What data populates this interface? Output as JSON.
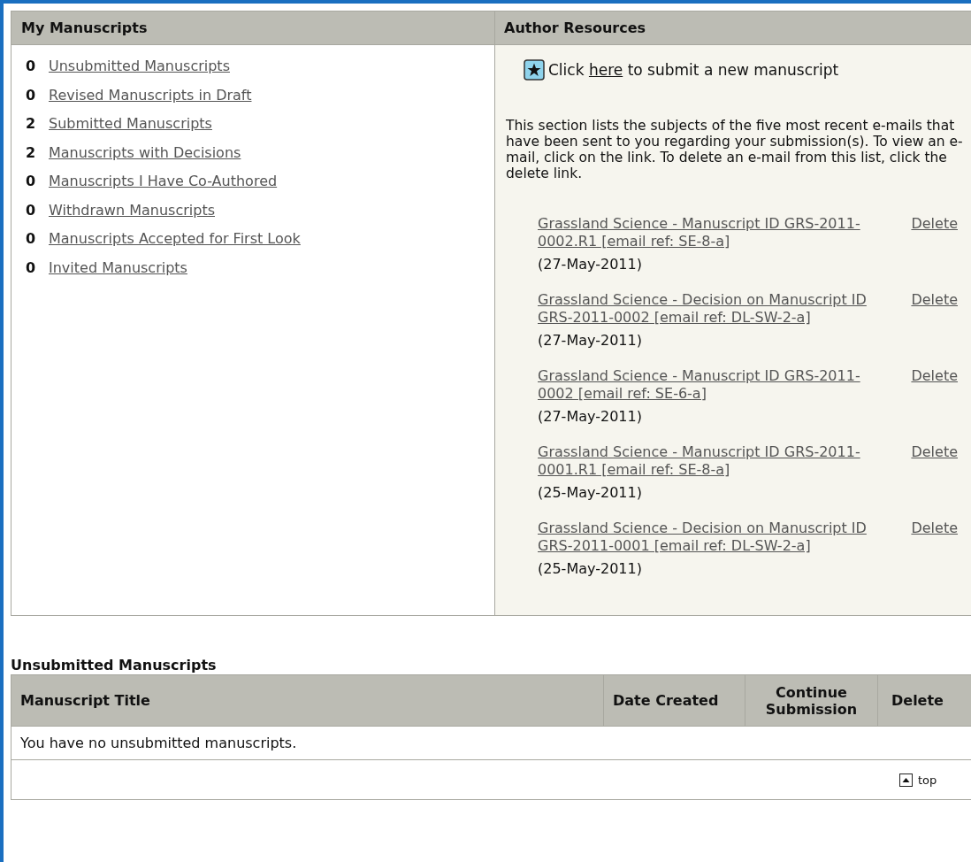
{
  "my_manuscripts": {
    "title": "My Manuscripts",
    "items": [
      {
        "count": "0",
        "label": "Unsubmitted Manuscripts"
      },
      {
        "count": "0",
        "label": "Revised Manuscripts in Draft"
      },
      {
        "count": "2",
        "label": "Submitted Manuscripts"
      },
      {
        "count": "2",
        "label": "Manuscripts with Decisions"
      },
      {
        "count": "0",
        "label": "Manuscripts I Have Co-Authored"
      },
      {
        "count": "0",
        "label": "Withdrawn Manuscripts"
      },
      {
        "count": "0",
        "label": "Manuscripts Accepted for First Look"
      },
      {
        "count": "0",
        "label": "Invited Manuscripts"
      }
    ]
  },
  "author_resources": {
    "title": "Author Resources",
    "submit_prefix": "Click",
    "submit_link": "here",
    "submit_suffix": "to submit a new manuscript",
    "description": "This section lists the subjects of the five most recent e-mails that have been sent to you regarding your submission(s). To view an e-mail, click on the link. To delete an e-mail from this list, click the delete link.",
    "emails": [
      {
        "subject": "Grassland Science - Manuscript ID GRS-2011-0002.R1 [email ref: SE-8-a]",
        "delete": "Delete",
        "date": "(27-May-2011)"
      },
      {
        "subject": "Grassland Science - Decision on Manuscript ID GRS-2011-0002 [email ref: DL-SW-2-a]",
        "delete": "Delete",
        "date": "(27-May-2011)"
      },
      {
        "subject": "Grassland Science - Manuscript ID GRS-2011-0002 [email ref: SE-6-a]",
        "delete": "Delete",
        "date": "(27-May-2011)"
      },
      {
        "subject": "Grassland Science - Manuscript ID GRS-2011-0001.R1 [email ref: SE-8-a]",
        "delete": "Delete",
        "date": "(25-May-2011)"
      },
      {
        "subject": "Grassland Science - Decision on Manuscript ID GRS-2011-0001 [email ref: DL-SW-2-a]",
        "delete": "Delete",
        "date": "(25-May-2011)"
      }
    ]
  },
  "unsubmitted": {
    "title": "Unsubmitted Manuscripts",
    "columns": [
      "Manuscript Title",
      "Date Created",
      "Continue Submission",
      "Delete"
    ],
    "empty_message": "You have no unsubmitted manuscripts.",
    "top_link": "top"
  }
}
